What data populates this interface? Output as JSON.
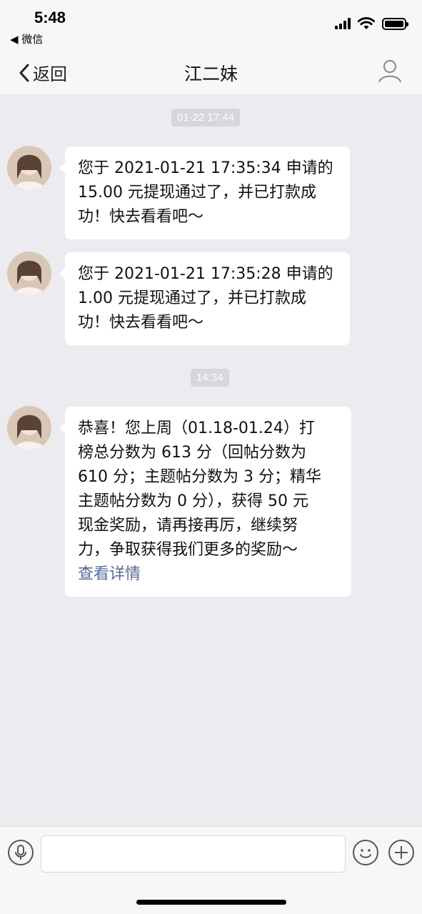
{
  "status_bar": {
    "time": "5:48",
    "back_app": "◀ 微信"
  },
  "header": {
    "back_label": "返回",
    "title": "江二妹"
  },
  "messages": [
    {
      "type": "time",
      "text": "01-22 17:44"
    },
    {
      "type": "msg",
      "lines": [
        "您于 2021-01-21 17:35:34 申请的",
        "15.00 元提现通过了，并已打款成",
        "功！快去看看吧～"
      ]
    },
    {
      "type": "msg",
      "lines": [
        "您于 2021-01-21 17:35:28 申请的",
        "1.00 元提现通过了，并已打款成",
        "功！快去看看吧～"
      ]
    },
    {
      "type": "time",
      "text": "14:34"
    },
    {
      "type": "msg",
      "lines": [
        "恭喜！您上周（01.18-01.24）打",
        "榜总分数为 613 分（回帖分数为",
        "610 分；主题帖分数为 3 分；精华",
        "主题帖分数为 0 分），获得 50 元",
        "现金奖励，请再接再厉，继续努",
        "力，争取获得我们更多的奖励～"
      ],
      "link": "查看详情"
    }
  ],
  "input_bar": {
    "placeholder": ""
  },
  "icons": {
    "back": "chevron-left-icon",
    "profile": "person-icon",
    "voice": "microphone-icon",
    "emoji": "smiley-icon",
    "more": "plus-icon"
  },
  "colors": {
    "link": "#576b95",
    "background": "#ebebf0",
    "bubble": "#ffffff"
  }
}
